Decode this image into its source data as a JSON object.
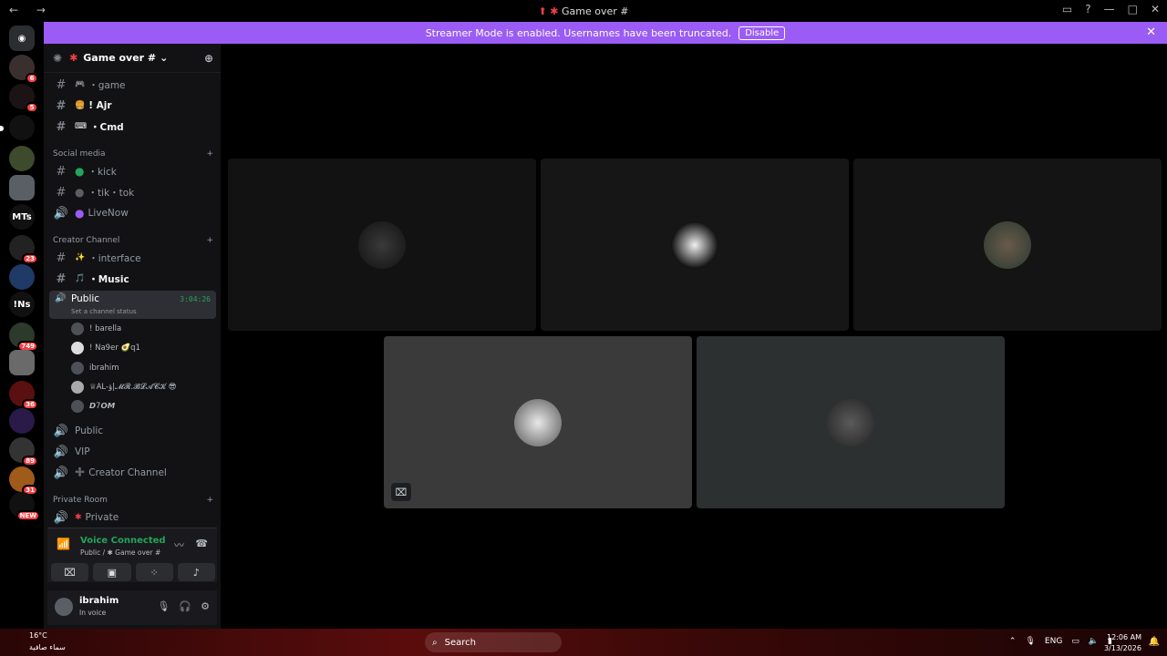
{
  "window": {
    "nav_label": "← →",
    "title": "Game over #",
    "title_icon": "⬆ ✱"
  },
  "streamer_banner": {
    "message": "Streamer Mode is enabled. Usernames have been truncated.",
    "button_label": "Disable"
  },
  "guild_rail": {
    "items": [
      {
        "label": "",
        "badge": "6"
      },
      {
        "label": "",
        "badge": "5"
      },
      {
        "label": "",
        "badge": ""
      },
      {
        "label": "",
        "badge": ""
      },
      {
        "label": "",
        "badge": ""
      },
      {
        "label": "MTs",
        "badge": ""
      },
      {
        "label": "",
        "badge": "23"
      },
      {
        "label": "",
        "badge": ""
      },
      {
        "label": "!Ns",
        "badge": ""
      },
      {
        "label": "",
        "badge": "749"
      },
      {
        "label": "",
        "badge": ""
      },
      {
        "label": "",
        "badge": "36"
      },
      {
        "label": "",
        "badge": ""
      },
      {
        "label": "",
        "badge": "89"
      },
      {
        "label": "",
        "badge": "31"
      },
      {
        "label": "",
        "badge": "NEW"
      }
    ]
  },
  "server": {
    "name": "Game over #",
    "channels_top": [
      {
        "name": "・game",
        "emoji": "🎮"
      },
      {
        "name": "! Ajr",
        "emoji": "🍔"
      },
      {
        "name": "・Cmd",
        "emoji": "⌨"
      }
    ],
    "category_social": "Social media",
    "channels_social": [
      {
        "name": "・kick",
        "emoji": "●"
      },
      {
        "name": "・tik・tok",
        "emoji": "●"
      },
      {
        "name": "LiveNow",
        "emoji": "●"
      }
    ],
    "category_creator": "Creator Channel",
    "channels_creator": [
      {
        "name": "・interface",
        "emoji": "✨"
      },
      {
        "name": "・Music",
        "emoji": "🎵"
      }
    ],
    "active_voice": {
      "name": "Public",
      "timer": "3:04:26",
      "status": "Set a channel status"
    },
    "voice_users": [
      {
        "name": "! barella"
      },
      {
        "name": "! Na9er 🥑q1"
      },
      {
        "name": "ibrahim"
      },
      {
        "name": "♕AL-ؤ|𝓜𝓡.𝓑𝓛𝓐𝓒𝓚 😎"
      },
      {
        "name": "𝘿7𝙊𝙈"
      }
    ],
    "channels_voice": [
      {
        "name": "Public",
        "emoji": ""
      },
      {
        "name": "VIP",
        "emoji": ""
      },
      {
        "name": "Creator Channel",
        "emoji": "➕"
      }
    ],
    "category_private": "Private Room",
    "channels_private": [
      {
        "name": "Private",
        "emoji": "✱"
      }
    ]
  },
  "voice_connected": {
    "title": "Voice Connected",
    "subtitle": "Public / ✱ Game over #"
  },
  "user_panel": {
    "name": "ibrahim",
    "status": "In voice"
  },
  "taskbar": {
    "temp": "16°C",
    "weather": "سماء صافية",
    "search": "Search",
    "lang": "ENG",
    "time": "12:06 AM",
    "date": "3/13/2026"
  },
  "colors": {
    "banner": "#9b5cf5",
    "voice_green": "#23a55a",
    "badge_red": "#f23f43"
  }
}
